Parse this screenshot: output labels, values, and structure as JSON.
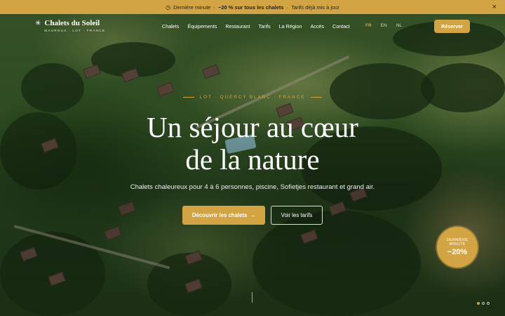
{
  "promo": {
    "icon": "clock-icon",
    "label": "Dernière minute",
    "sep1": "·",
    "offer": "−20 % sur tous les chalets",
    "sep2": "·",
    "note": "Tarifs déjà mis à jour",
    "close": "×"
  },
  "header": {
    "logo_mark": "✳",
    "logo_name": "Chalets du Soleil",
    "logo_sub": "MAUROUX · LOT · FRANCE",
    "nav": [
      "Chalets",
      "Équipements",
      "Restaurant",
      "Tarifs",
      "La Région",
      "Accès",
      "Contact"
    ],
    "langs": [
      "FR",
      "EN",
      "NL"
    ],
    "reserve": "Réserver"
  },
  "hero": {
    "eyebrow": "LOT · QUERCY BLANC · FRANCE",
    "title_line1": "Un séjour au cœur",
    "title_line2": "de la nature",
    "subtitle": "Chalets chaleureux pour 4 à 6 personnes, piscine, Sofietjes restaurant et grand air.",
    "cta_primary": "Découvrir les chalets",
    "cta_primary_arrow": "→",
    "cta_secondary": "Voir les tarifs"
  },
  "badge": {
    "line1": "DERNIÈRE",
    "line2": "MINUTE",
    "value": "−20%"
  },
  "carousel": {
    "slides": 3,
    "active": 0
  },
  "colors": {
    "accent": "#d3a443",
    "text": "#ffffff"
  }
}
